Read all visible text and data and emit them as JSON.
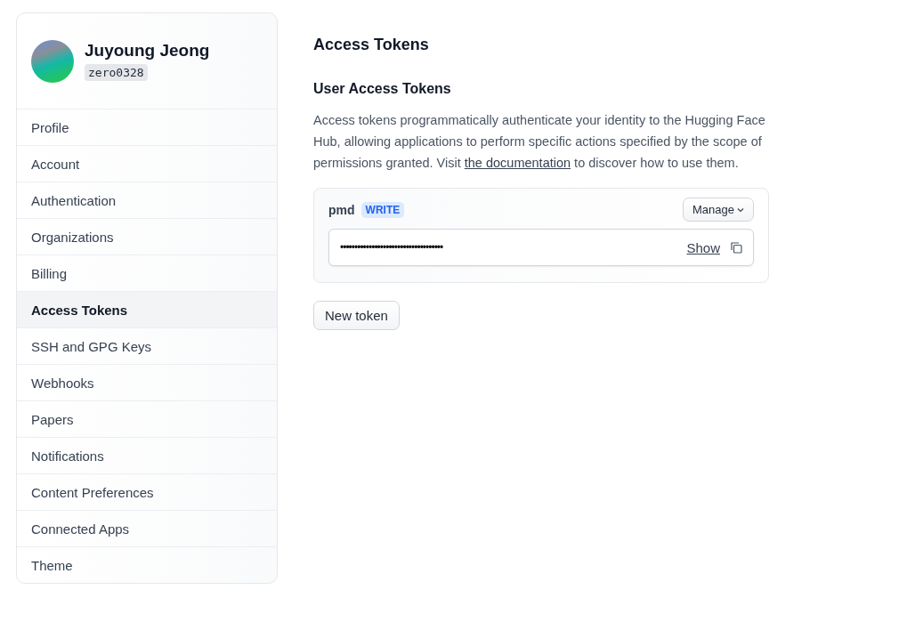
{
  "user": {
    "name": "Juyoung Jeong",
    "username": "zero0328"
  },
  "sidebar": {
    "items": [
      {
        "label": "Profile",
        "selected": false
      },
      {
        "label": "Account",
        "selected": false
      },
      {
        "label": "Authentication",
        "selected": false
      },
      {
        "label": "Organizations",
        "selected": false
      },
      {
        "label": "Billing",
        "selected": false
      },
      {
        "label": "Access Tokens",
        "selected": true
      },
      {
        "label": "SSH and GPG Keys",
        "selected": false
      },
      {
        "label": "Webhooks",
        "selected": false
      },
      {
        "label": "Papers",
        "selected": false
      },
      {
        "label": "Notifications",
        "selected": false
      },
      {
        "label": "Content Preferences",
        "selected": false
      },
      {
        "label": "Connected Apps",
        "selected": false
      },
      {
        "label": "Theme",
        "selected": false
      }
    ]
  },
  "main": {
    "title": "Access Tokens",
    "subtitle": "User Access Tokens",
    "description": {
      "before": "Access tokens programmatically authenticate your identity to the Hugging Face Hub, allowing applications to perform specific actions specified by the scope of permissions granted. Visit ",
      "link": "the documentation",
      "after": " to discover how to use them."
    },
    "tokens": [
      {
        "name": "pmd",
        "role": "WRITE",
        "manage": "Manage",
        "value": "••••••••••••••••••••••••••••••••••••",
        "show": "Show"
      }
    ],
    "new_token": "New token"
  }
}
